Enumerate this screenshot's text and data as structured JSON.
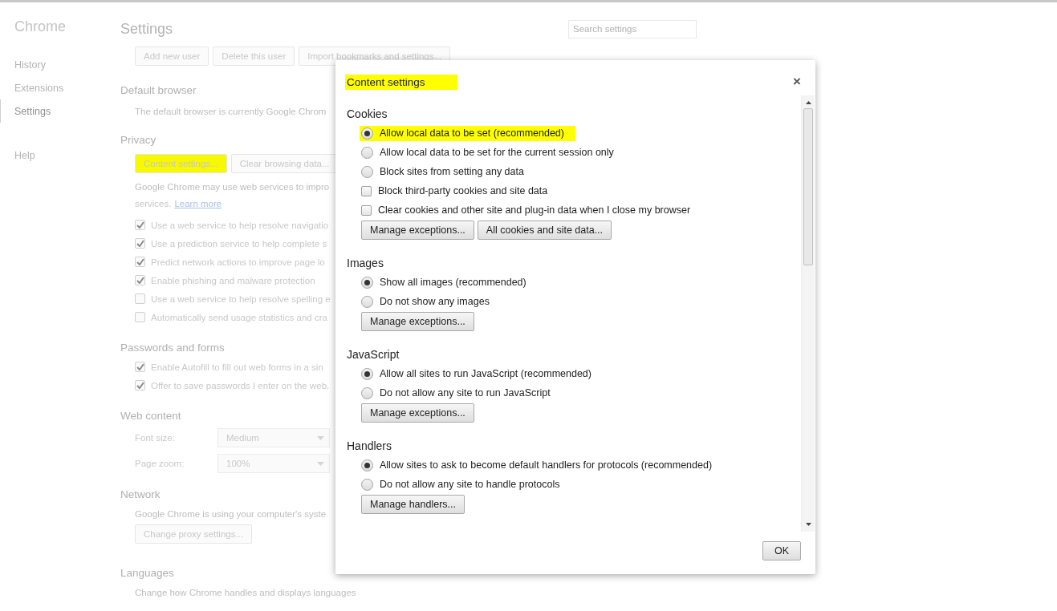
{
  "sidebar": {
    "title": "Chrome",
    "items": [
      {
        "label": "History",
        "selected": false
      },
      {
        "label": "Extensions",
        "selected": false
      },
      {
        "label": "Settings",
        "selected": true
      }
    ],
    "footer_items": [
      {
        "label": "Help",
        "selected": false
      }
    ]
  },
  "header": {
    "title": "Settings",
    "search": {
      "placeholder": "Search settings"
    }
  },
  "user_buttons": [
    {
      "label": "Add new user"
    },
    {
      "label": "Delete this user"
    },
    {
      "label": "Import bookmarks and settings..."
    }
  ],
  "default_browser": {
    "title": "Default browser",
    "text": "The default browser is currently Google Chrom"
  },
  "privacy": {
    "title": "Privacy",
    "buttons": [
      {
        "label": "Content settings...",
        "highlighted": true
      },
      {
        "label": "Clear browsing data...",
        "highlighted": false
      }
    ],
    "text": "Google Chrome may use web services to impro",
    "text_2": "services.",
    "link": "Learn more",
    "checkboxes": [
      {
        "label": "Use a web service to help resolve navigatio",
        "checked": true
      },
      {
        "label": "Use a prediction service to help complete s",
        "checked": true
      },
      {
        "label": "Predict network actions to improve page lo",
        "checked": true
      },
      {
        "label": "Enable phishing and malware protection",
        "checked": true
      },
      {
        "label": "Use a web service to help resolve spelling e",
        "checked": false
      },
      {
        "label": "Automatically send usage statistics and cra",
        "checked": false
      }
    ]
  },
  "passwords": {
    "title": "Passwords and forms",
    "checkboxes": [
      {
        "label": "Enable Autofill to fill out web forms in a sin",
        "checked": true
      },
      {
        "label": "Offer to save passwords I enter on the web.",
        "checked": true
      }
    ]
  },
  "web_content": {
    "title": "Web content",
    "fields": [
      {
        "label": "Font size:",
        "value": "Medium"
      },
      {
        "label": "Page zoom:",
        "value": "100%"
      }
    ]
  },
  "network": {
    "title": "Network",
    "text": "Google Chrome is using your computer's syste",
    "button": "Change proxy settings..."
  },
  "languages": {
    "title": "Languages",
    "text": "Change how Chrome handles and displays languages"
  },
  "dialog": {
    "title": "Content settings",
    "title_highlighted": true,
    "close": "×",
    "ok": "OK",
    "sections": [
      {
        "title": "Cookies",
        "options": [
          {
            "kind": "radio",
            "label": "Allow local data to be set (recommended)",
            "selected": true,
            "highlighted": true
          },
          {
            "kind": "radio",
            "label": "Allow local data to be set for the current session only",
            "selected": false,
            "highlighted": false
          },
          {
            "kind": "radio",
            "label": "Block sites from setting any data",
            "selected": false,
            "highlighted": false
          },
          {
            "kind": "checkbox",
            "label": "Block third-party cookies and site data",
            "checked": false,
            "highlighted": false
          },
          {
            "kind": "checkbox",
            "label": "Clear cookies and other site and plug-in data when I close my browser",
            "checked": false,
            "highlighted": false
          }
        ],
        "buttons": [
          "Manage exceptions...",
          "All cookies and site data..."
        ]
      },
      {
        "title": "Images",
        "options": [
          {
            "kind": "radio",
            "label": "Show all images (recommended)",
            "selected": true,
            "highlighted": false
          },
          {
            "kind": "radio",
            "label": "Do not show any images",
            "selected": false,
            "highlighted": false
          }
        ],
        "buttons": [
          "Manage exceptions..."
        ]
      },
      {
        "title": "JavaScript",
        "options": [
          {
            "kind": "radio",
            "label": "Allow all sites to run JavaScript (recommended)",
            "selected": true,
            "highlighted": false
          },
          {
            "kind": "radio",
            "label": "Do not allow any site to run JavaScript",
            "selected": false,
            "highlighted": false
          }
        ],
        "buttons": [
          "Manage exceptions..."
        ]
      },
      {
        "title": "Handlers",
        "options": [
          {
            "kind": "radio",
            "label": "Allow sites to ask to become default handlers for protocols (recommended)",
            "selected": true,
            "highlighted": false
          },
          {
            "kind": "radio",
            "label": "Do not allow any site to handle protocols",
            "selected": false,
            "highlighted": false
          }
        ],
        "buttons": [
          "Manage handlers..."
        ]
      }
    ]
  }
}
